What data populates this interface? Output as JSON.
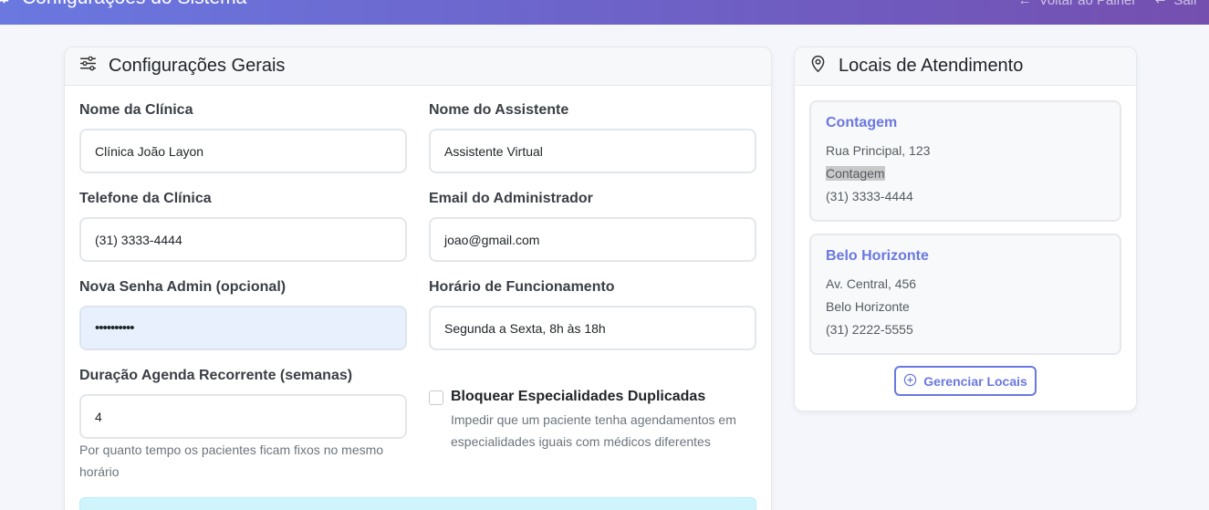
{
  "header": {
    "title": "Configurações do Sistema",
    "back_label": "Voltar ao Painel",
    "logout_label": "Sair"
  },
  "general": {
    "title": "Configurações Gerais",
    "clinic_name": {
      "label": "Nome da Clínica",
      "value": "Clínica João Layon"
    },
    "assistant_name": {
      "label": "Nome do Assistente",
      "value": "Assistente Virtual"
    },
    "clinic_phone": {
      "label": "Telefone da Clínica",
      "value": "(31) 3333-4444"
    },
    "admin_email": {
      "label": "Email do Administrador",
      "value": "joao@gmail.com"
    },
    "admin_password": {
      "label": "Nova Senha Admin (opcional)",
      "value": "••••••••••"
    },
    "opening_hours": {
      "label": "Horário de Funcionamento",
      "value": "Segunda a Sexta, 8h às 18h"
    },
    "recurring": {
      "label": "Duração Agenda Recorrente (semanas)",
      "value": "4",
      "help_line1": "Por quanto tempo os pacientes ficam fixos no mesmo",
      "help_line2": "horário"
    },
    "block_duplicates": {
      "label": "Bloquear Especialidades Duplicadas",
      "checked": false,
      "help_line1": "Impedir que um paciente tenha agendamentos em",
      "help_line2": "especialidades iguais com médicos diferentes"
    }
  },
  "locations": {
    "title": "Locais de Atendimento",
    "items": [
      {
        "name": "Contagem",
        "address": "Rua Principal, 123",
        "city": "Contagem",
        "phone": "(31) 3333-4444"
      },
      {
        "name": "Belo Horizonte",
        "address": "Av. Central, 456",
        "city": "Belo Horizonte",
        "phone": "(31) 2222-5555"
      }
    ],
    "manage_label": "Gerenciar Locais"
  },
  "colors": {
    "accent": "#6a78e0",
    "header_gradient_end": "#744fb0",
    "alert_bg": "#cff4fc"
  }
}
